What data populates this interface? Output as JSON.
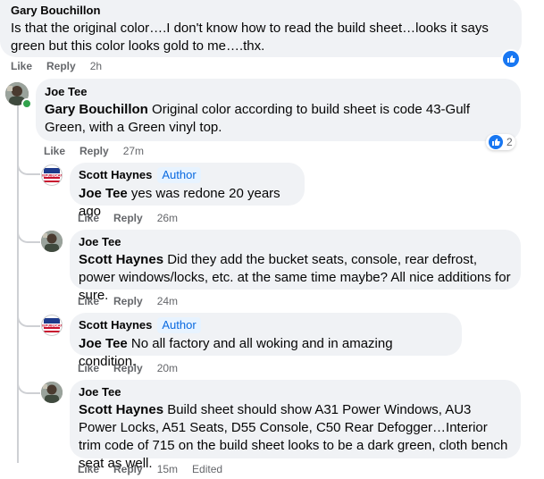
{
  "comments": [
    {
      "author": "Gary Bouchillon",
      "text": "Is that the original color….I don't know how to read the build sheet…looks it says green but this color looks gold to me….thx.",
      "like": "Like",
      "reply": "Reply",
      "time": "2h"
    },
    {
      "author": "Joe Tee",
      "mention": "Gary Bouchillon",
      "text": " Original color according to build sheet is code 43-Gulf Green, with a Green vinyl top.",
      "like": "Like",
      "reply": "Reply",
      "time": "27m",
      "reaction_count": "2"
    },
    {
      "author": "Scott Haynes",
      "badge": "Author",
      "mention": "Joe Tee",
      "text": " yes was redone 20 years ago",
      "like": "Like",
      "reply": "Reply",
      "time": "26m"
    },
    {
      "author": "Joe Tee",
      "mention": "Scott Haynes",
      "text": " Did they add the bucket seats, console, rear defrost, power windows/locks, etc. at the same time maybe? All nice additions for sure.",
      "like": "Like",
      "reply": "Reply",
      "time": "24m"
    },
    {
      "author": "Scott Haynes",
      "badge": "Author",
      "mention": "Joe Tee",
      "text": " No all factory and all woking and in amazing condition.",
      "like": "Like",
      "reply": "Reply",
      "time": "20m"
    },
    {
      "author": "Joe Tee",
      "mention": "Scott Haynes",
      "text": " Build sheet should show A31 Power Windows, AU3 Power Locks, A51 Seats, D55 Console, C50 Rear Defogger…Interior trim code of 715 on the build sheet looks to be a dark green, cloth bench seat as well.",
      "like": "Like",
      "reply": "Reply",
      "time": "15m",
      "edited": "Edited"
    }
  ],
  "avatar_badge_text": "VOTE REPUBLICAN",
  "colors": {
    "bubble": "#f0f2f5",
    "like_blue": "#1877f2",
    "author_badge_bg": "#e7f3ff",
    "author_badge_text": "#0a6ae0"
  }
}
